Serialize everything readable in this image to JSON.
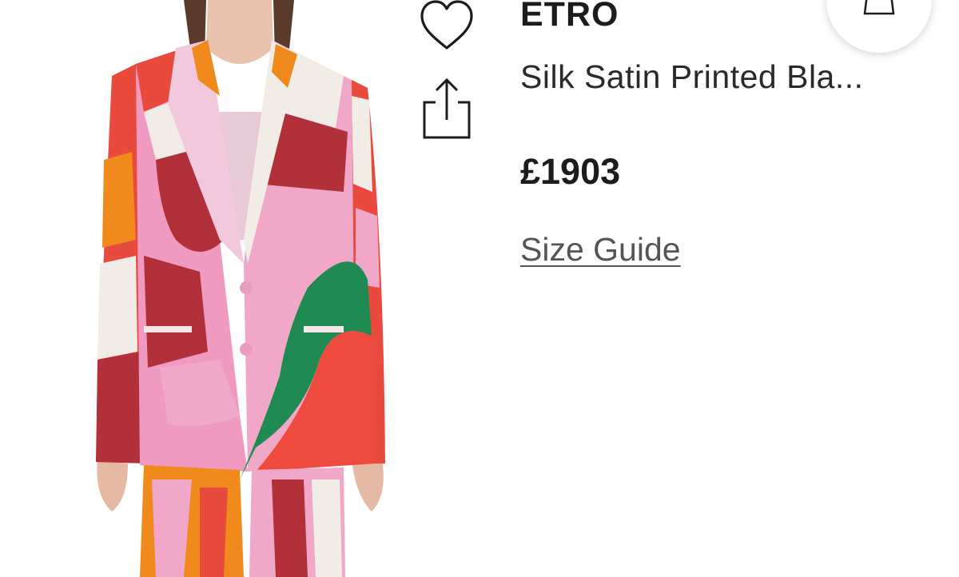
{
  "product": {
    "brand": "ETRO",
    "name": "Silk Satin Printed Bla...",
    "price": "£1903",
    "size_guide_label": "Size Guide"
  },
  "icons": {
    "wishlist": "heart-icon",
    "share": "share-icon",
    "bag": "shopping-bag-icon"
  },
  "colors": {
    "text_primary": "#1c1c1c",
    "text_secondary": "#555555",
    "background": "#ffffff"
  }
}
